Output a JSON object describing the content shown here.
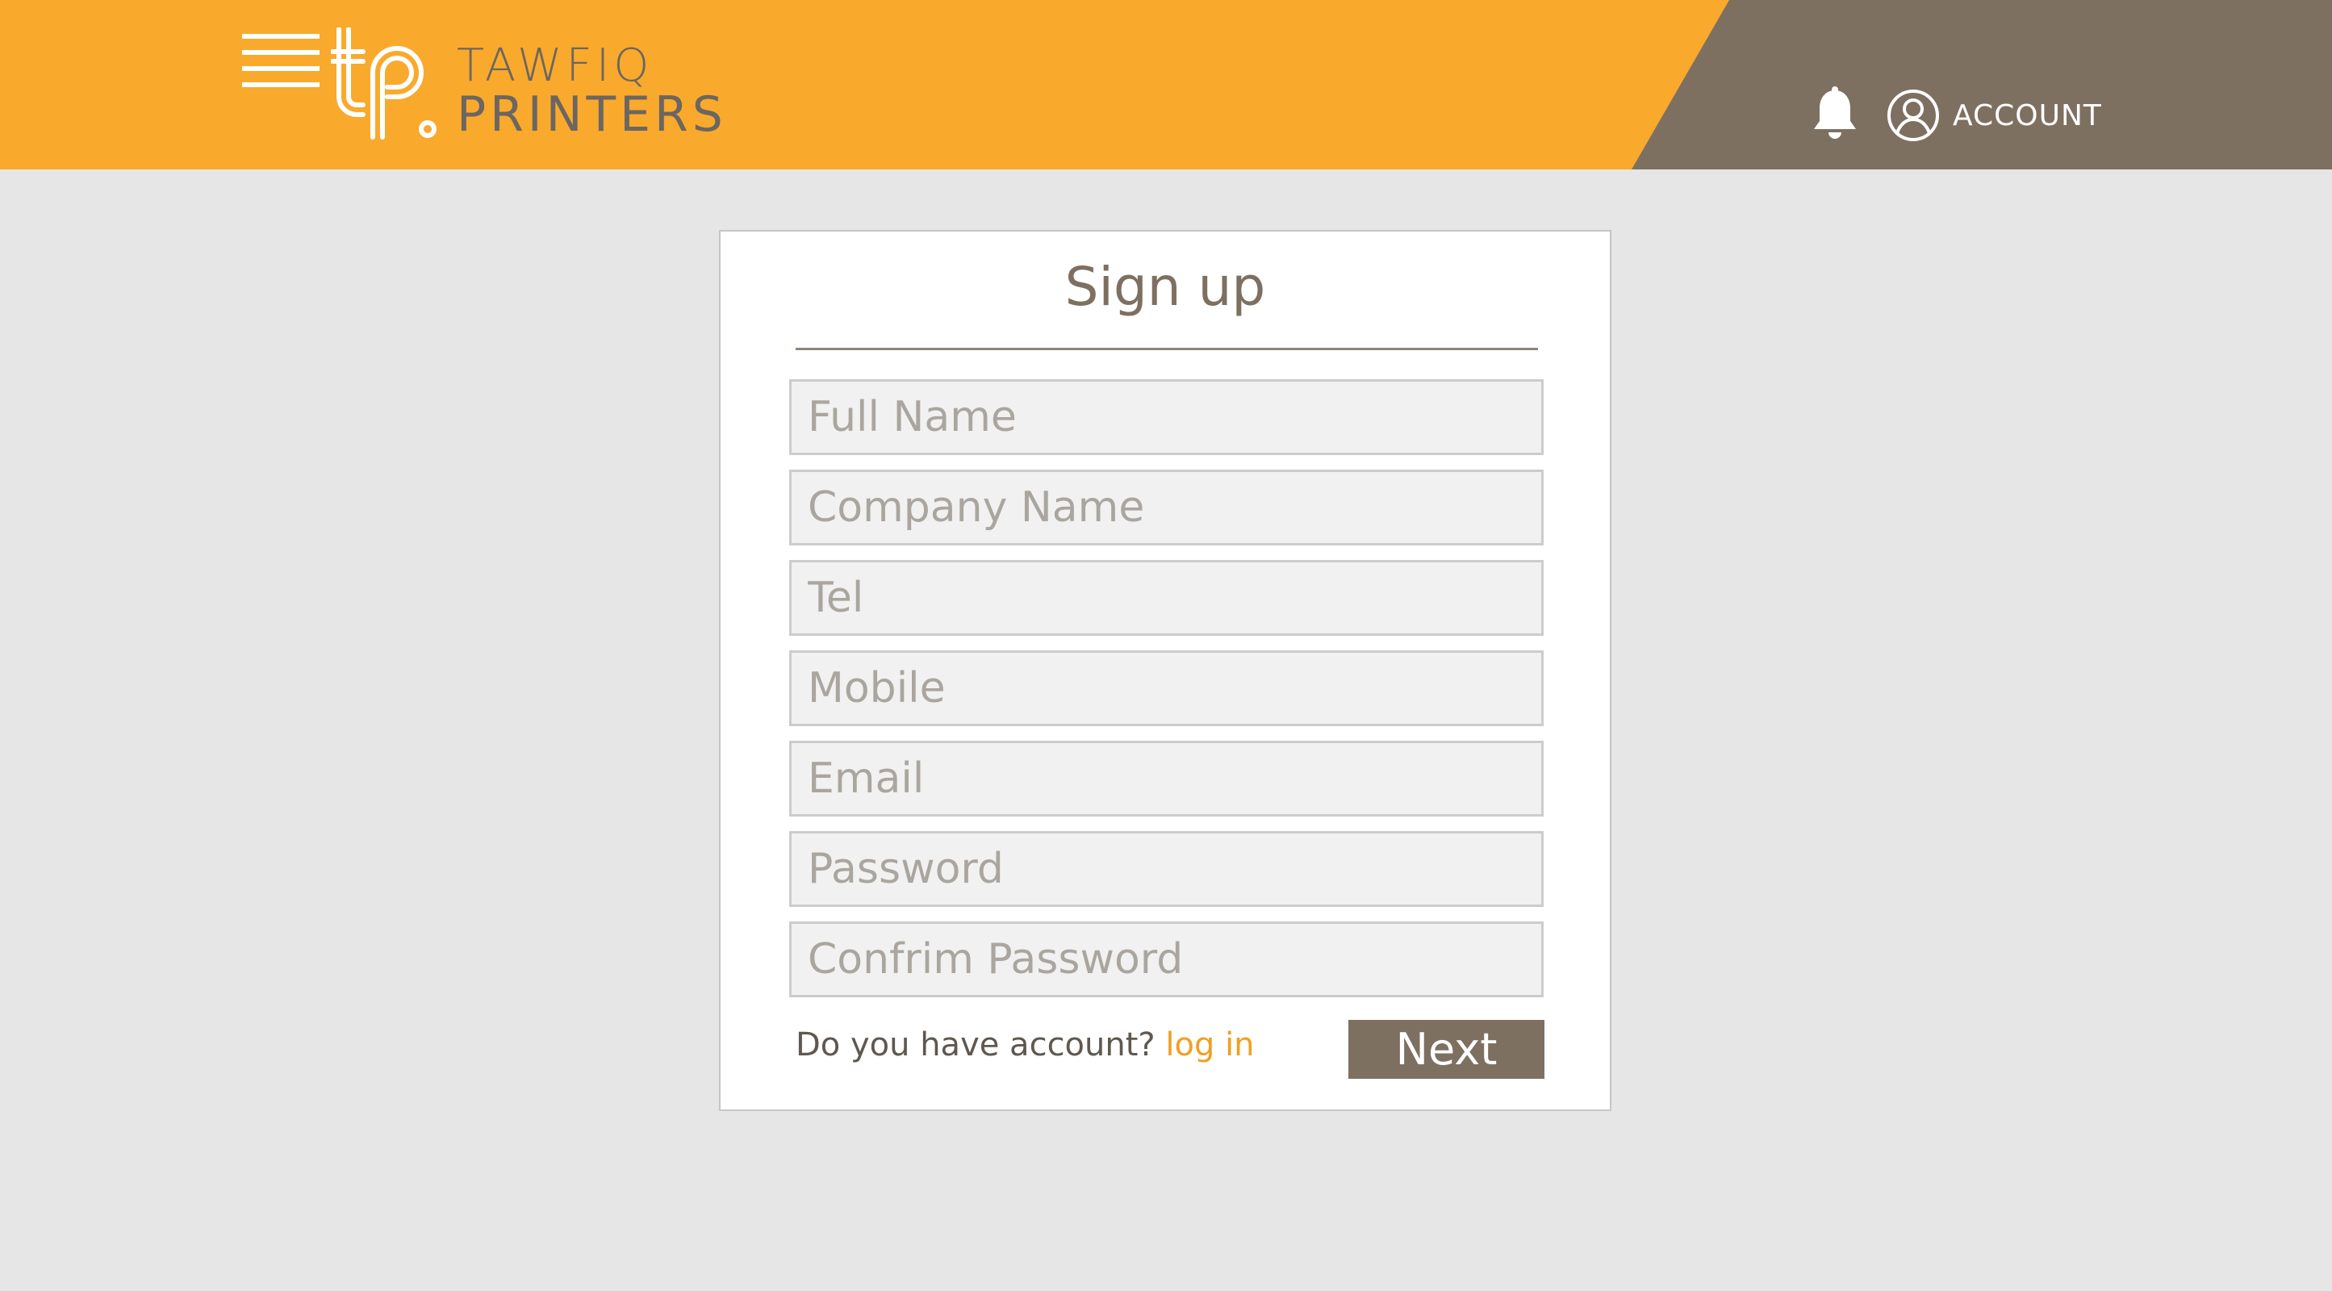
{
  "brand": {
    "line1": "TAWFIQ",
    "line2": "PRINTERS",
    "logo_icon": "tp-logo-icon",
    "primary_color": "#f9a92c",
    "secondary_color": "#7e7061"
  },
  "header": {
    "menu_icon": "hamburger-menu-icon",
    "notification_icon": "bell-icon",
    "account_icon": "user-circle-icon",
    "account_label": "ACCOUNT"
  },
  "signup": {
    "title": "Sign up",
    "fields": {
      "full_name": {
        "placeholder": "Full Name",
        "value": ""
      },
      "company_name": {
        "placeholder": "Company Name",
        "value": ""
      },
      "tel": {
        "placeholder": "Tel",
        "value": ""
      },
      "mobile": {
        "placeholder": "Mobile",
        "value": ""
      },
      "email": {
        "placeholder": "Email",
        "value": ""
      },
      "password": {
        "placeholder": "Password",
        "value": ""
      },
      "confirm_password": {
        "placeholder": "Confrim Password",
        "value": ""
      }
    },
    "login_prompt": "Do you have account?",
    "login_link": "log in",
    "link_color": "#f0a023",
    "next_label": "Next"
  }
}
